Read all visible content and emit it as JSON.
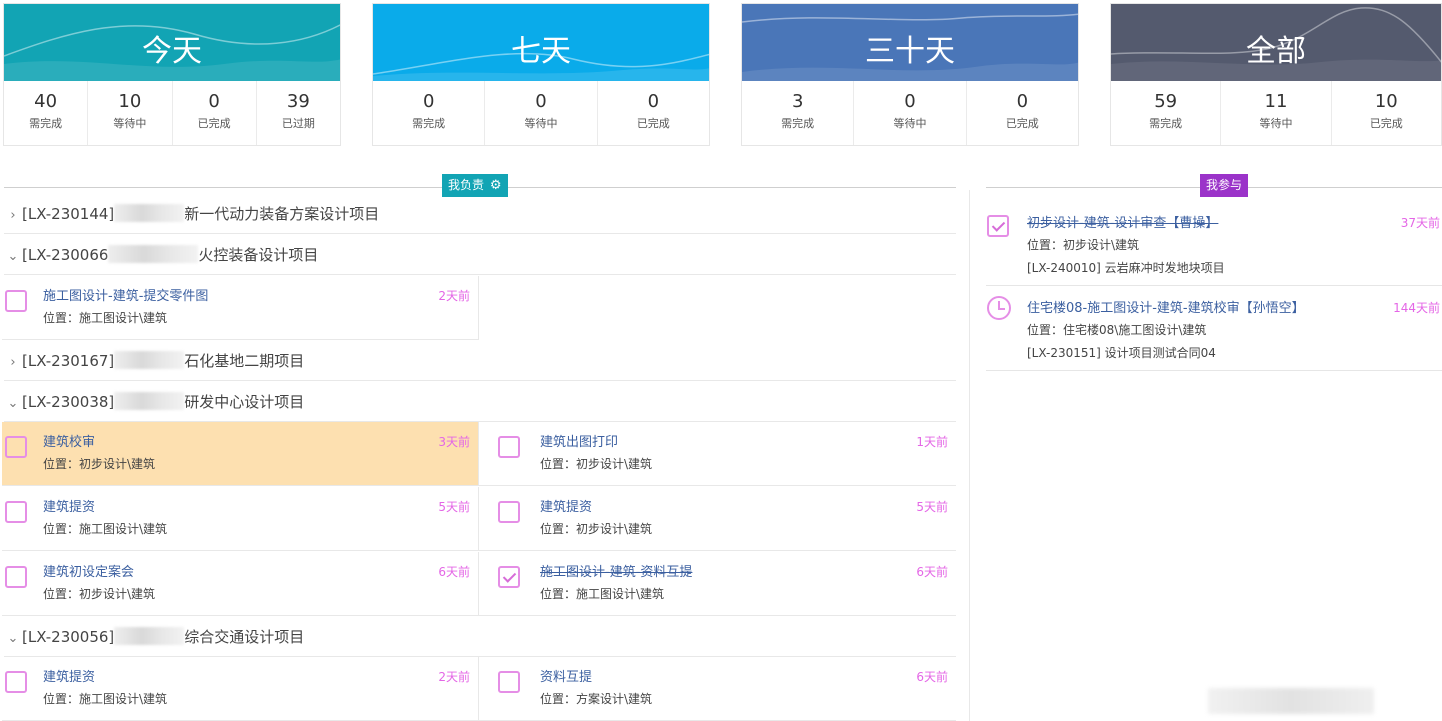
{
  "cards": [
    {
      "title": "今天",
      "color": "#12a4b4",
      "stats": [
        {
          "value": "40",
          "label": "需完成"
        },
        {
          "value": "10",
          "label": "等待中"
        },
        {
          "value": "0",
          "label": "已完成"
        },
        {
          "value": "39",
          "label": "已过期"
        }
      ]
    },
    {
      "title": "七天",
      "color": "#0aabea",
      "stats": [
        {
          "value": "0",
          "label": "需完成"
        },
        {
          "value": "0",
          "label": "等待中"
        },
        {
          "value": "0",
          "label": "已完成"
        }
      ]
    },
    {
      "title": "三十天",
      "color": "#4a76b8",
      "stats": [
        {
          "value": "3",
          "label": "需完成"
        },
        {
          "value": "0",
          "label": "等待中"
        },
        {
          "value": "0",
          "label": "已完成"
        }
      ]
    },
    {
      "title": "全部",
      "color": "#545a6e",
      "stats": [
        {
          "value": "59",
          "label": "需完成"
        },
        {
          "value": "11",
          "label": "等待中"
        },
        {
          "value": "10",
          "label": "已完成"
        }
      ]
    }
  ],
  "mine": {
    "label": "我负责",
    "color": "#12a4b4",
    "icon": "gear-icon"
  },
  "participate": {
    "label": "我参与",
    "color": "#9b33c9"
  },
  "projects": [
    {
      "code": "[LX-230144]",
      "name": "新一代动力装备方案设计项目",
      "expanded": false
    },
    {
      "code": "[LX-230066",
      "name": "火控装备设计项目",
      "expanded": true
    },
    {
      "code": "[LX-230167]",
      "name": "石化基地二期项目",
      "expanded": false
    },
    {
      "code": "[LX-230038]",
      "name": "研发中心设计项目",
      "expanded": true
    },
    {
      "code": "[LX-230056]",
      "name": "综合交通设计项目",
      "expanded": true
    }
  ],
  "tasks": [
    {
      "title": "施工图设计-建筑-提交零件图",
      "location": "位置：施工图设计\\建筑",
      "age": "2天前",
      "done": false
    },
    {
      "title": "建筑校审",
      "location": "位置：初步设计\\建筑",
      "age": "3天前",
      "done": false,
      "highlight": true
    },
    {
      "title": "建筑出图打印",
      "location": "位置：初步设计\\建筑",
      "age": "1天前",
      "done": false
    },
    {
      "title": "建筑提资",
      "location": "位置：施工图设计\\建筑",
      "age": "5天前",
      "done": false
    },
    {
      "title": "建筑提资",
      "location": "位置：初步设计\\建筑",
      "age": "5天前",
      "done": false
    },
    {
      "title": "建筑初设定案会",
      "location": "位置：初步设计\\建筑",
      "age": "6天前",
      "done": false
    },
    {
      "title": "施工图设计-建筑-资料互提",
      "location": "位置：施工图设计\\建筑",
      "age": "6天前",
      "done": true
    },
    {
      "title": "建筑提资",
      "location": "位置：施工图设计\\建筑",
      "age": "2天前",
      "done": false
    },
    {
      "title": "资料互提",
      "location": "位置：方案设计\\建筑",
      "age": "6天前",
      "done": false
    }
  ],
  "participate_tasks": [
    {
      "title": "初步设计-建筑-设计审查【曹操】",
      "location": "位置：初步设计\\建筑",
      "project": "[LX-240010] 云岩麻冲时发地块项目",
      "age": "37天前",
      "done": true,
      "icon": "checkbox-checked-icon"
    },
    {
      "title": "住宅楼08-施工图设计-建筑-建筑校审【孙悟空】",
      "location": "位置：住宅楼08\\施工图设计\\建筑",
      "project": "[LX-230151] 设计项目测试合同04",
      "age": "144天前",
      "done": false,
      "icon": "clock-icon"
    }
  ]
}
